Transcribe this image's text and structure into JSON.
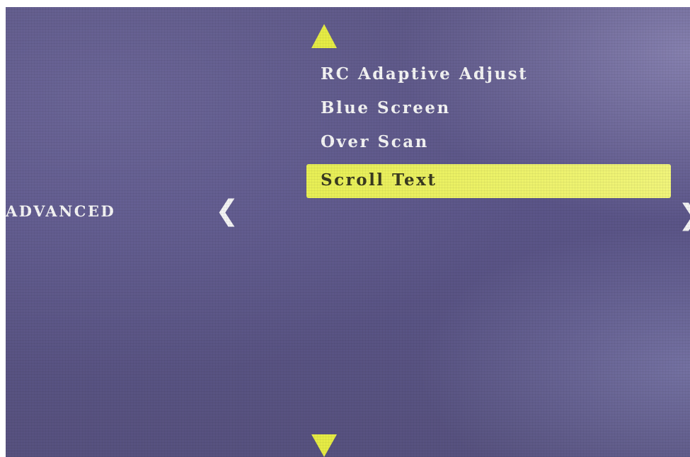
{
  "osd": {
    "section_label": "ADVANCED",
    "prev_glyph": "❮",
    "next_glyph": "❯",
    "menu_items": [
      {
        "label": "RC Adaptive Adjust",
        "selected": false
      },
      {
        "label": "Blue Screen",
        "selected": false
      },
      {
        "label": "Over Scan",
        "selected": false
      },
      {
        "label": "Scroll Text",
        "selected": true
      }
    ]
  },
  "icons": {
    "scroll_up": "triangle-up-icon",
    "scroll_down": "triangle-down-icon",
    "prev": "chevron-left-icon",
    "next": "chevron-right-icon"
  },
  "colors": {
    "background": "#5a5483",
    "highlight": "#e8ef55",
    "text": "#f4f4f4",
    "arrow": "#e6ec45"
  }
}
